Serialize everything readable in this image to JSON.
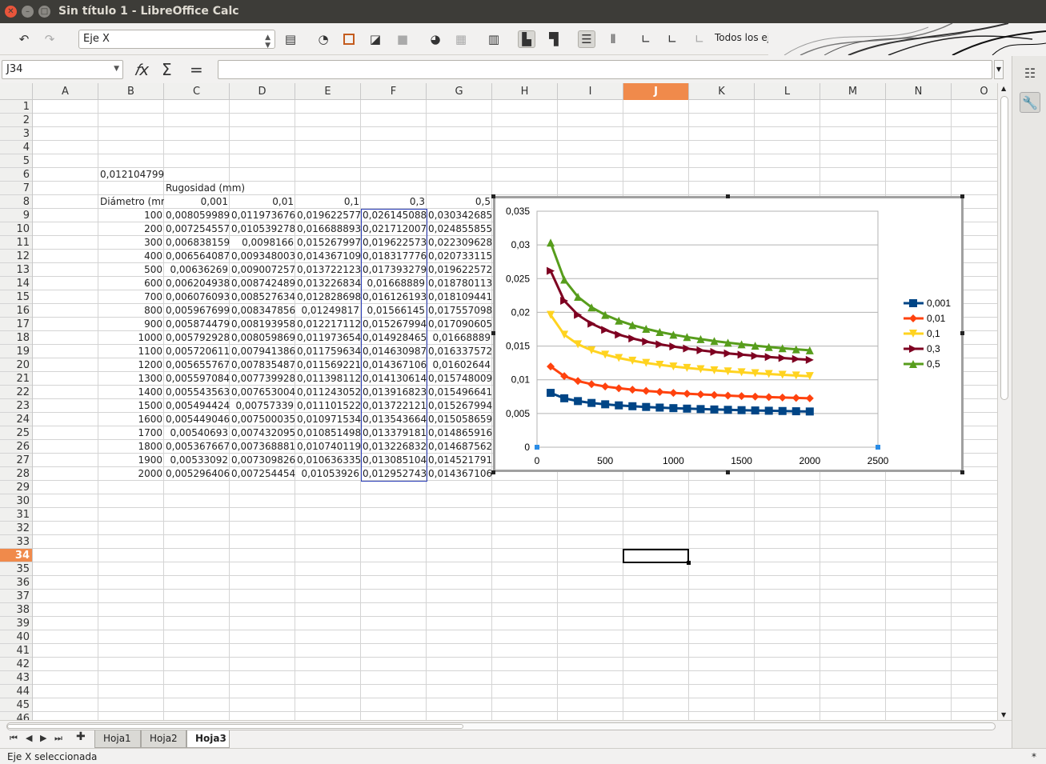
{
  "window": {
    "title": "Sin título 1 - LibreOffice Calc"
  },
  "toolbar": {
    "selected_element": "Eje X",
    "axes_label": "Todos los ejes"
  },
  "formula_bar": {
    "name_box": "J34",
    "formula": ""
  },
  "columns": [
    "A",
    "B",
    "C",
    "D",
    "E",
    "F",
    "G",
    "H",
    "I",
    "J",
    "K",
    "L",
    "M",
    "N",
    "O"
  ],
  "selected_column": "J",
  "rows_visible": [
    1,
    2,
    3,
    4,
    5,
    6,
    7,
    8,
    9,
    10,
    11,
    12,
    13,
    14,
    15,
    16,
    17,
    18,
    19,
    20,
    21,
    22,
    23,
    24,
    25,
    26,
    27,
    28,
    29,
    30,
    31,
    32,
    33,
    34,
    35,
    36,
    37,
    38,
    39,
    40,
    41,
    42,
    43,
    44,
    45,
    46
  ],
  "selected_row": 34,
  "cells": {
    "b6": "0,012104799",
    "c7": "Rugosidad (mm)",
    "b8": "Diámetro (mm",
    "c8": "0,001",
    "d8": "0,01",
    "e8": "0,1",
    "f8": "0,3",
    "g8": "0,5"
  },
  "table_rows": [
    [
      "100",
      "0,008059989",
      "0,011973676",
      "0,019622577",
      "0,026145088",
      "0,030342685"
    ],
    [
      "200",
      "0,007254557",
      "0,010539278",
      "0,016688893",
      "0,021712007",
      "0,024855855"
    ],
    [
      "300",
      "0,006838159",
      "0,0098166",
      "0,015267997",
      "0,019622573",
      "0,022309628"
    ],
    [
      "400",
      "0,006564087",
      "0,009348003",
      "0,014367109",
      "0,018317776",
      "0,020733115"
    ],
    [
      "500",
      "0,00636269",
      "0,009007257",
      "0,013722123",
      "0,017393279",
      "0,019622572"
    ],
    [
      "600",
      "0,006204938",
      "0,008742489",
      "0,013226834",
      "0,01668889",
      "0,018780113"
    ],
    [
      "700",
      "0,006076093",
      "0,008527634",
      "0,012828698",
      "0,016126193",
      "0,018109441"
    ],
    [
      "800",
      "0,005967699",
      "0,008347856",
      "0,01249817",
      "0,01566145",
      "0,017557098"
    ],
    [
      "900",
      "0,005874479",
      "0,008193958",
      "0,012217112",
      "0,015267994",
      "0,017090605"
    ],
    [
      "1000",
      "0,005792928",
      "0,008059869",
      "0,011973654",
      "0,014928465",
      "0,01668889"
    ],
    [
      "1100",
      "0,005720611",
      "0,007941386",
      "0,011759634",
      "0,014630987",
      "0,016337572"
    ],
    [
      "1200",
      "0,005655767",
      "0,007835487",
      "0,011569221",
      "0,014367106",
      "0,01602644"
    ],
    [
      "1300",
      "0,005597084",
      "0,007739928",
      "0,011398112",
      "0,014130614",
      "0,015748009"
    ],
    [
      "1400",
      "0,005543563",
      "0,007653004",
      "0,011243052",
      "0,013916823",
      "0,015496641"
    ],
    [
      "1500",
      "0,005494424",
      "0,00757339",
      "0,011101522",
      "0,013722121",
      "0,015267994"
    ],
    [
      "1600",
      "0,005449046",
      "0,007500035",
      "0,010971534",
      "0,013543664",
      "0,015058659"
    ],
    [
      "1700",
      "0,00540693",
      "0,007432095",
      "0,010851498",
      "0,013379181",
      "0,014865916"
    ],
    [
      "1800",
      "0,005367667",
      "0,007368881",
      "0,010740119",
      "0,013226832",
      "0,014687562"
    ],
    [
      "1900",
      "0,00533092",
      "0,007309826",
      "0,010636335",
      "0,013085104",
      "0,014521791"
    ],
    [
      "2000",
      "0,005296406",
      "0,007254454",
      "0,01053926",
      "0,012952743",
      "0,014367106"
    ]
  ],
  "sheets": [
    "Hoja1",
    "Hoja2",
    "Hoja3"
  ],
  "active_sheet": "Hoja3",
  "status": {
    "left": "Eje X seleccionada",
    "right": "*"
  },
  "chart_data": {
    "type": "scatter",
    "x": [
      100,
      200,
      300,
      400,
      500,
      600,
      700,
      800,
      900,
      1000,
      1100,
      1200,
      1300,
      1400,
      1500,
      1600,
      1700,
      1800,
      1900,
      2000
    ],
    "series": [
      {
        "name": "0,001",
        "color": "#004586",
        "marker": "square",
        "values": [
          0.008059989,
          0.007254557,
          0.006838159,
          0.006564087,
          0.00636269,
          0.006204938,
          0.006076093,
          0.005967699,
          0.005874479,
          0.005792928,
          0.005720611,
          0.005655767,
          0.005597084,
          0.005543563,
          0.005494424,
          0.005449046,
          0.00540693,
          0.005367667,
          0.00533092,
          0.005296406
        ]
      },
      {
        "name": "0,01",
        "color": "#ff420e",
        "marker": "diamond",
        "values": [
          0.011973676,
          0.010539278,
          0.0098166,
          0.009348003,
          0.009007257,
          0.008742489,
          0.008527634,
          0.008347856,
          0.008193958,
          0.008059869,
          0.007941386,
          0.007835487,
          0.007739928,
          0.007653004,
          0.00757339,
          0.007500035,
          0.007432095,
          0.007368881,
          0.007309826,
          0.007254454
        ]
      },
      {
        "name": "0,1",
        "color": "#ffd320",
        "marker": "triangle-down",
        "values": [
          0.019622577,
          0.016688893,
          0.015267997,
          0.014367109,
          0.013722123,
          0.013226834,
          0.012828698,
          0.01249817,
          0.012217112,
          0.011973654,
          0.011759634,
          0.011569221,
          0.011398112,
          0.011243052,
          0.011101522,
          0.010971534,
          0.010851498,
          0.010740119,
          0.010636335,
          0.01053926
        ]
      },
      {
        "name": "0,3",
        "color": "#7e0021",
        "marker": "triangle-right",
        "values": [
          0.026145088,
          0.021712007,
          0.019622573,
          0.018317776,
          0.017393279,
          0.01668889,
          0.016126193,
          0.01566145,
          0.015267994,
          0.014928465,
          0.014630987,
          0.014367106,
          0.014130614,
          0.013916823,
          0.013722121,
          0.013543664,
          0.013379181,
          0.013226832,
          0.013085104,
          0.012952743
        ]
      },
      {
        "name": "0,5",
        "color": "#579d1c",
        "marker": "triangle-up",
        "values": [
          0.030342685,
          0.024855855,
          0.022309628,
          0.020733115,
          0.019622572,
          0.018780113,
          0.018109441,
          0.017557098,
          0.017090605,
          0.01668889,
          0.016337572,
          0.01602644,
          0.015748009,
          0.015496641,
          0.015267994,
          0.015058659,
          0.014865916,
          0.014687562,
          0.014521791,
          0.014367106
        ]
      }
    ],
    "xlim": [
      0,
      2500
    ],
    "ylim": [
      0,
      0.035
    ],
    "x_ticks": [
      "0",
      "500",
      "1000",
      "1500",
      "2000",
      "2500"
    ],
    "y_ticks": [
      "0",
      "0,005",
      "0,01",
      "0,015",
      "0,02",
      "0,025",
      "0,03",
      "0,035"
    ],
    "grid": true,
    "legend": "right"
  }
}
